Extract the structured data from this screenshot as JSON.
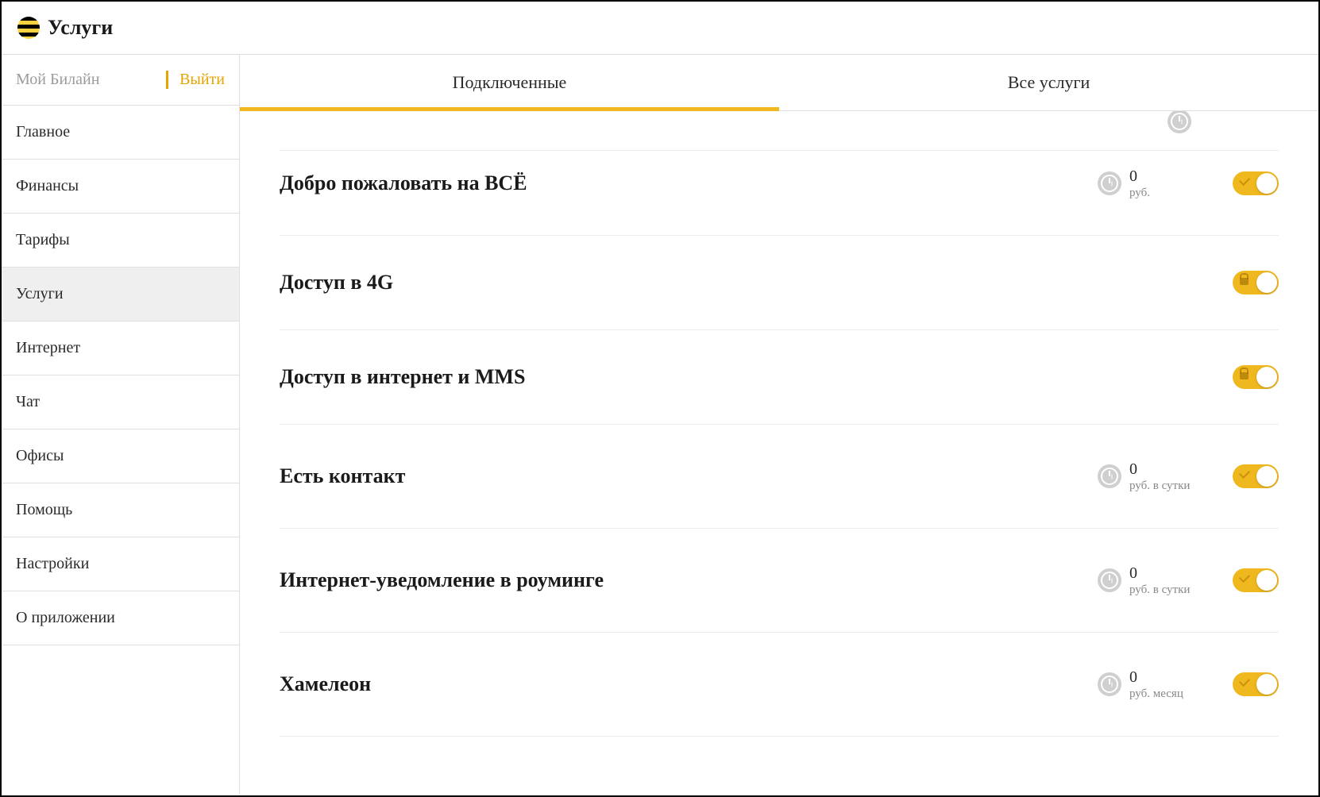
{
  "header": {
    "title": "Услуги"
  },
  "sidebar": {
    "account_label": "Мой Билайн",
    "logout_label": "Выйти",
    "items": [
      {
        "label": "Главное",
        "active": false
      },
      {
        "label": "Финансы",
        "active": false
      },
      {
        "label": "Тарифы",
        "active": false
      },
      {
        "label": "Услуги",
        "active": true
      },
      {
        "label": "Интернет",
        "active": false
      },
      {
        "label": "Чат",
        "active": false
      },
      {
        "label": "Офисы",
        "active": false
      },
      {
        "label": "Помощь",
        "active": false
      },
      {
        "label": "Настройки",
        "active": false
      },
      {
        "label": "О приложении",
        "active": false
      }
    ]
  },
  "tabs": [
    {
      "label": "Подключенные",
      "active": true
    },
    {
      "label": "Все услуги",
      "active": false
    }
  ],
  "services": [
    {
      "name": "Добро пожаловать на ВСЁ",
      "price_amount": "0",
      "price_unit": "руб.",
      "has_price": true,
      "toggle_on": true,
      "locked": false
    },
    {
      "name": "Доступ в 4G",
      "price_amount": "",
      "price_unit": "",
      "has_price": false,
      "toggle_on": true,
      "locked": true
    },
    {
      "name": "Доступ в интернет и MMS",
      "price_amount": "",
      "price_unit": "",
      "has_price": false,
      "toggle_on": true,
      "locked": true
    },
    {
      "name": "Есть контакт",
      "price_amount": "0",
      "price_unit": "руб. в сутки",
      "has_price": true,
      "toggle_on": true,
      "locked": false
    },
    {
      "name": "Интернет-уведомление в роуминге",
      "price_amount": "0",
      "price_unit": "руб. в сутки",
      "has_price": true,
      "toggle_on": true,
      "locked": false
    },
    {
      "name": "Хамелеон",
      "price_amount": "0",
      "price_unit": "руб. месяц",
      "has_price": true,
      "toggle_on": true,
      "locked": false
    }
  ],
  "colors": {
    "accent": "#f0b81f",
    "text": "#2a2a2a",
    "muted": "#9b9b9b"
  }
}
